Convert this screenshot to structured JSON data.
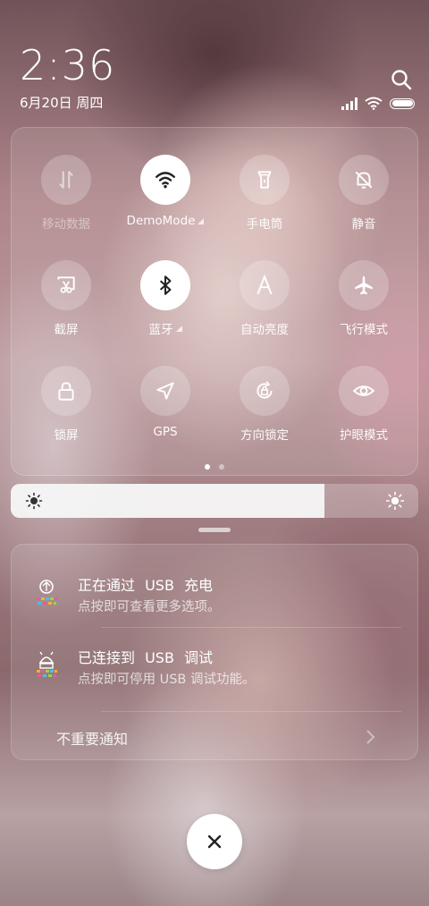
{
  "status_bar": {
    "time": "2:36",
    "date": "6月20日 周四"
  },
  "quick_settings": {
    "tiles": [
      {
        "label": "移动数据",
        "icon": "mobile-data-icon",
        "active": false,
        "dim": true
      },
      {
        "label": "DemoMode",
        "icon": "wifi-icon",
        "active": true,
        "expandable": true
      },
      {
        "label": "手电筒",
        "icon": "flashlight-icon",
        "active": false
      },
      {
        "label": "静音",
        "icon": "mute-bell-icon",
        "active": false
      },
      {
        "label": "截屏",
        "icon": "screenshot-icon",
        "active": false
      },
      {
        "label": "蓝牙",
        "icon": "bluetooth-icon",
        "active": true,
        "expandable": true
      },
      {
        "label": "自动亮度",
        "icon": "auto-brightness-icon",
        "active": false
      },
      {
        "label": "飞行模式",
        "icon": "airplane-icon",
        "active": false
      },
      {
        "label": "锁屏",
        "icon": "lock-icon",
        "active": false
      },
      {
        "label": "GPS",
        "icon": "gps-icon",
        "active": false
      },
      {
        "label": "方向锁定",
        "icon": "rotation-lock-icon",
        "active": false
      },
      {
        "label": "护眼模式",
        "icon": "eye-icon",
        "active": false
      }
    ],
    "page_count": 2,
    "current_page": 1
  },
  "brightness": {
    "level": 0.77
  },
  "notifications": [
    {
      "title": "正在通过 USB 充电",
      "subtitle": "点按即可查看更多选项。",
      "icon": "android-system-icon"
    },
    {
      "title": "已连接到 USB 调试",
      "subtitle": "点按即可停用 USB 调试功能。",
      "icon": "android-debug-icon"
    }
  ],
  "unimportant_label": "不重要通知",
  "colors": {
    "tile_active": "#ffffff",
    "tile_inactive": "rgba(255,255,255,0.22)"
  }
}
